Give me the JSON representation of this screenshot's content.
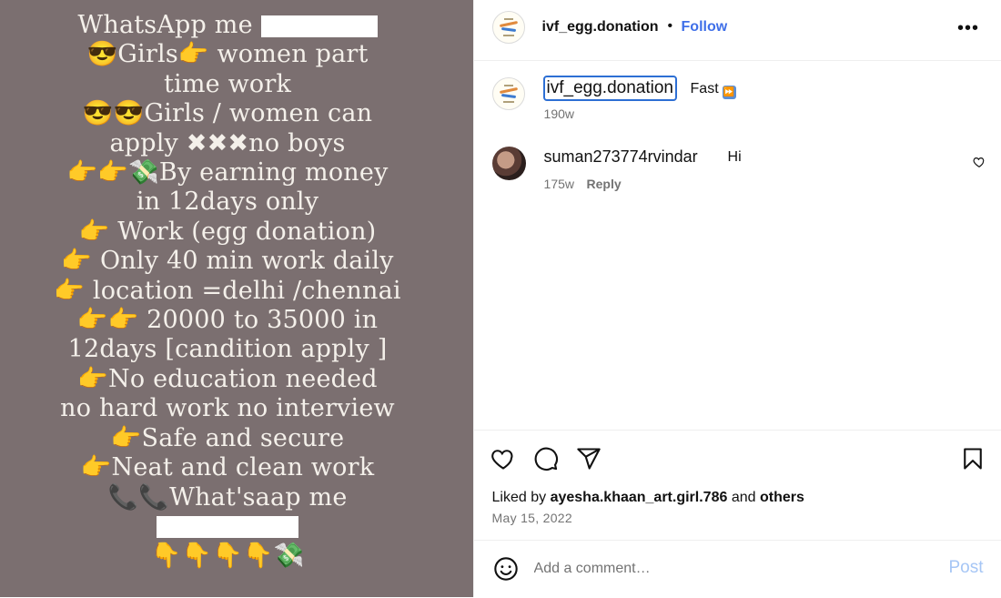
{
  "post_image": {
    "lines": [
      {
        "a": "WhatsApp me",
        "redacted": true
      },
      {
        "a": "😎Girls👉 women part"
      },
      {
        "a": "time work"
      },
      {
        "a": "😎😎Girls / women can"
      },
      {
        "a": "apply   ✖✖✖no boys"
      },
      {
        "a": "👉👉💸By earning money"
      },
      {
        "a": "in 12days only"
      },
      {
        "a": "👉 Work (egg donation)"
      },
      {
        "a": "👉 Only 40 min work daily"
      },
      {
        "a": "👉 location =delhi /chennai"
      },
      {
        "a": "👉👉 20000 to 35000 in"
      },
      {
        "a": "12days  [candition apply ]"
      },
      {
        "a": "👉No education  needed"
      },
      {
        "a": "no hard work no interview"
      },
      {
        "a": "👉Safe and secure"
      },
      {
        "a": "👉Neat and clean work"
      },
      {
        "a": "📞📞What'saap me"
      },
      {
        "a": "",
        "redacted": true
      },
      {
        "a": "👇👇👇👇💸"
      }
    ]
  },
  "header": {
    "username": "ivf_egg.donation",
    "separator": "•",
    "follow_label": "Follow",
    "more_icon": "more-horizontal-icon"
  },
  "caption": {
    "username": "ivf_egg.donation",
    "text": "Fast",
    "emoji": "⏩",
    "time": "190w"
  },
  "comments": [
    {
      "username": "suman273774rvindar",
      "text": "Hi",
      "time": "175w",
      "reply_label": "Reply"
    }
  ],
  "actions": {
    "liked_by_prefix": "Liked by",
    "liked_by_user": "ayesha.khaan_art.girl.786",
    "liked_by_and": "and",
    "liked_by_others": "others",
    "date": "May 15, 2022"
  },
  "comment_bar": {
    "placeholder": "Add a comment…",
    "post_label": "Post"
  },
  "colors": {
    "image_bg": "#7b6f70",
    "image_text": "#f4f0ea",
    "follow": "#3f6fe8",
    "post_disabled": "#a6c6f5",
    "muted": "#737373"
  }
}
